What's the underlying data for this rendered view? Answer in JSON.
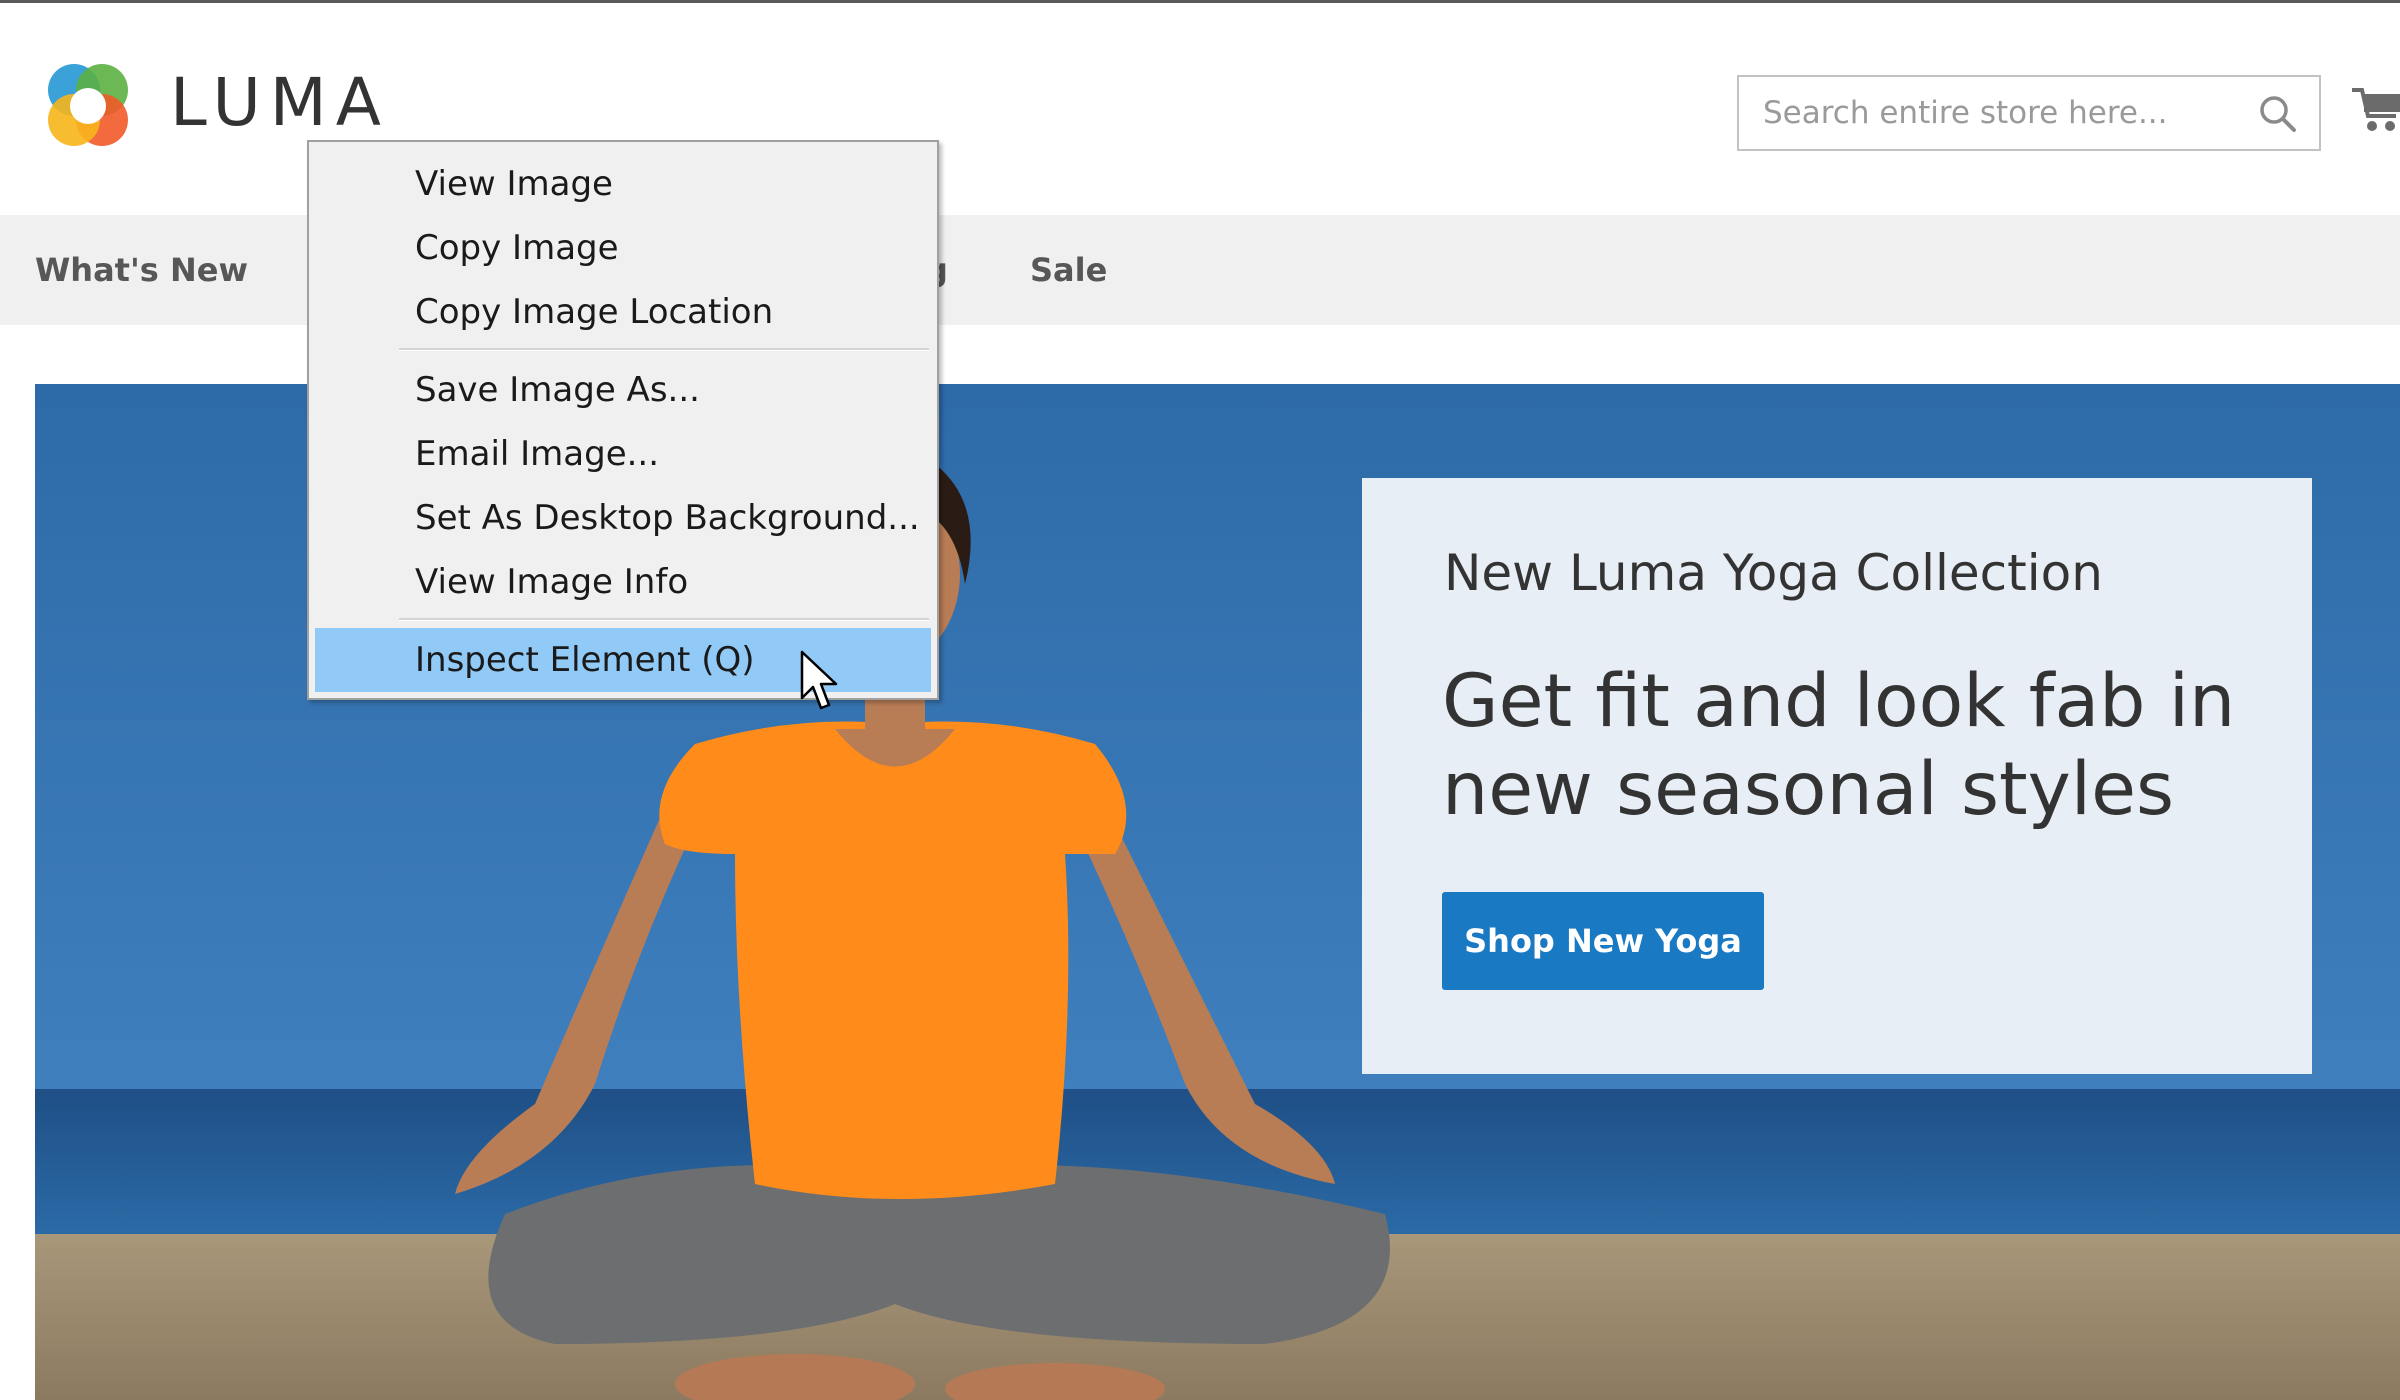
{
  "header": {
    "logo_text": "LUMA",
    "search": {
      "placeholder": "Search entire store here...",
      "value": ""
    }
  },
  "nav": {
    "items": [
      {
        "label": "What's New"
      },
      {
        "label": "g"
      },
      {
        "label": "Sale"
      }
    ]
  },
  "hero": {
    "subtitle": "New Luma Yoga Collection",
    "title": "Get fit and look fab in new seasonal styles",
    "button_label": "Shop New Yoga"
  },
  "context_menu": {
    "items": [
      {
        "label": "View Image",
        "access_key": "I"
      },
      {
        "label": "Copy Image",
        "access_key": "y"
      },
      {
        "label": "Copy Image Location",
        "access_key": "o"
      },
      {
        "label": "Save Image As...",
        "access_key": "v"
      },
      {
        "label": "Email Image...",
        "access_key": "g"
      },
      {
        "label": "Set As Desktop Background...",
        "access_key": "S"
      },
      {
        "label": "View Image Info",
        "access_key": "f"
      },
      {
        "label": "Inspect Element (Q)",
        "access_key": "Q",
        "highlighted": true
      }
    ]
  },
  "colors": {
    "accent": "#1979c3",
    "menu_highlight": "#91c9f7",
    "nav_background": "#f0f0f0",
    "hero_sky": "#2e6ba6",
    "shirt": "#ff8c1a"
  }
}
